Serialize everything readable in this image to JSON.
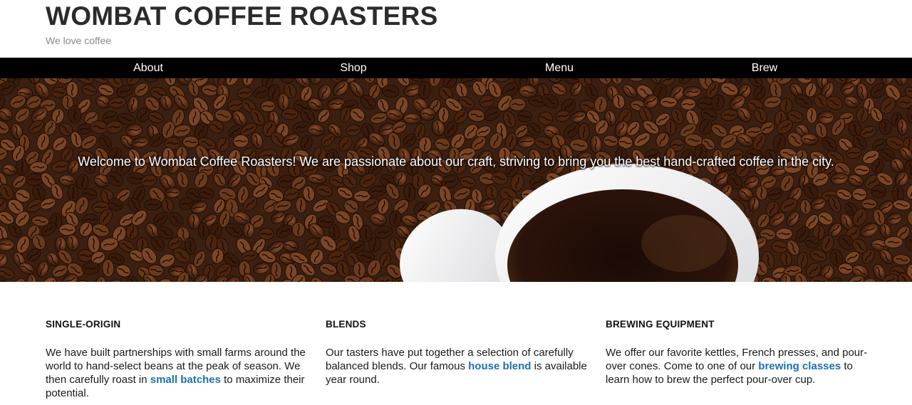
{
  "header": {
    "title": "WOMBAT COFFEE ROASTERS",
    "tagline": "We love coffee"
  },
  "nav": {
    "items": [
      "About",
      "Shop",
      "Menu",
      "Brew"
    ]
  },
  "hero": {
    "text": "Welcome to Wombat Coffee Roasters! We are passionate about our craft, striving to bring you the best hand-crafted coffee in the city.",
    "image": "coffee-beans-and-cup-photo"
  },
  "features": [
    {
      "heading": "SINGLE-ORIGIN",
      "text_before": "We have built partnerships with small farms around the world to hand-select beans at the peak of season. We then carefully roast in ",
      "link": "small batches",
      "text_after": " to maximize their potential."
    },
    {
      "heading": "BLENDS",
      "text_before": "Our tasters have put together a selection of carefully balanced blends. Our famous ",
      "link": "house blend",
      "text_after": " is available year round."
    },
    {
      "heading": "BREWING EQUIPMENT",
      "text_before": "We offer our favorite kettles, French presses, and pour-over cones. Come to one of our ",
      "link": "brewing classes",
      "text_after": " to learn how to brew the perfect pour-over cup."
    }
  ],
  "colors": {
    "nav_background": "#000000",
    "link": "#1f6fb2",
    "title": "#2b2b2b"
  }
}
